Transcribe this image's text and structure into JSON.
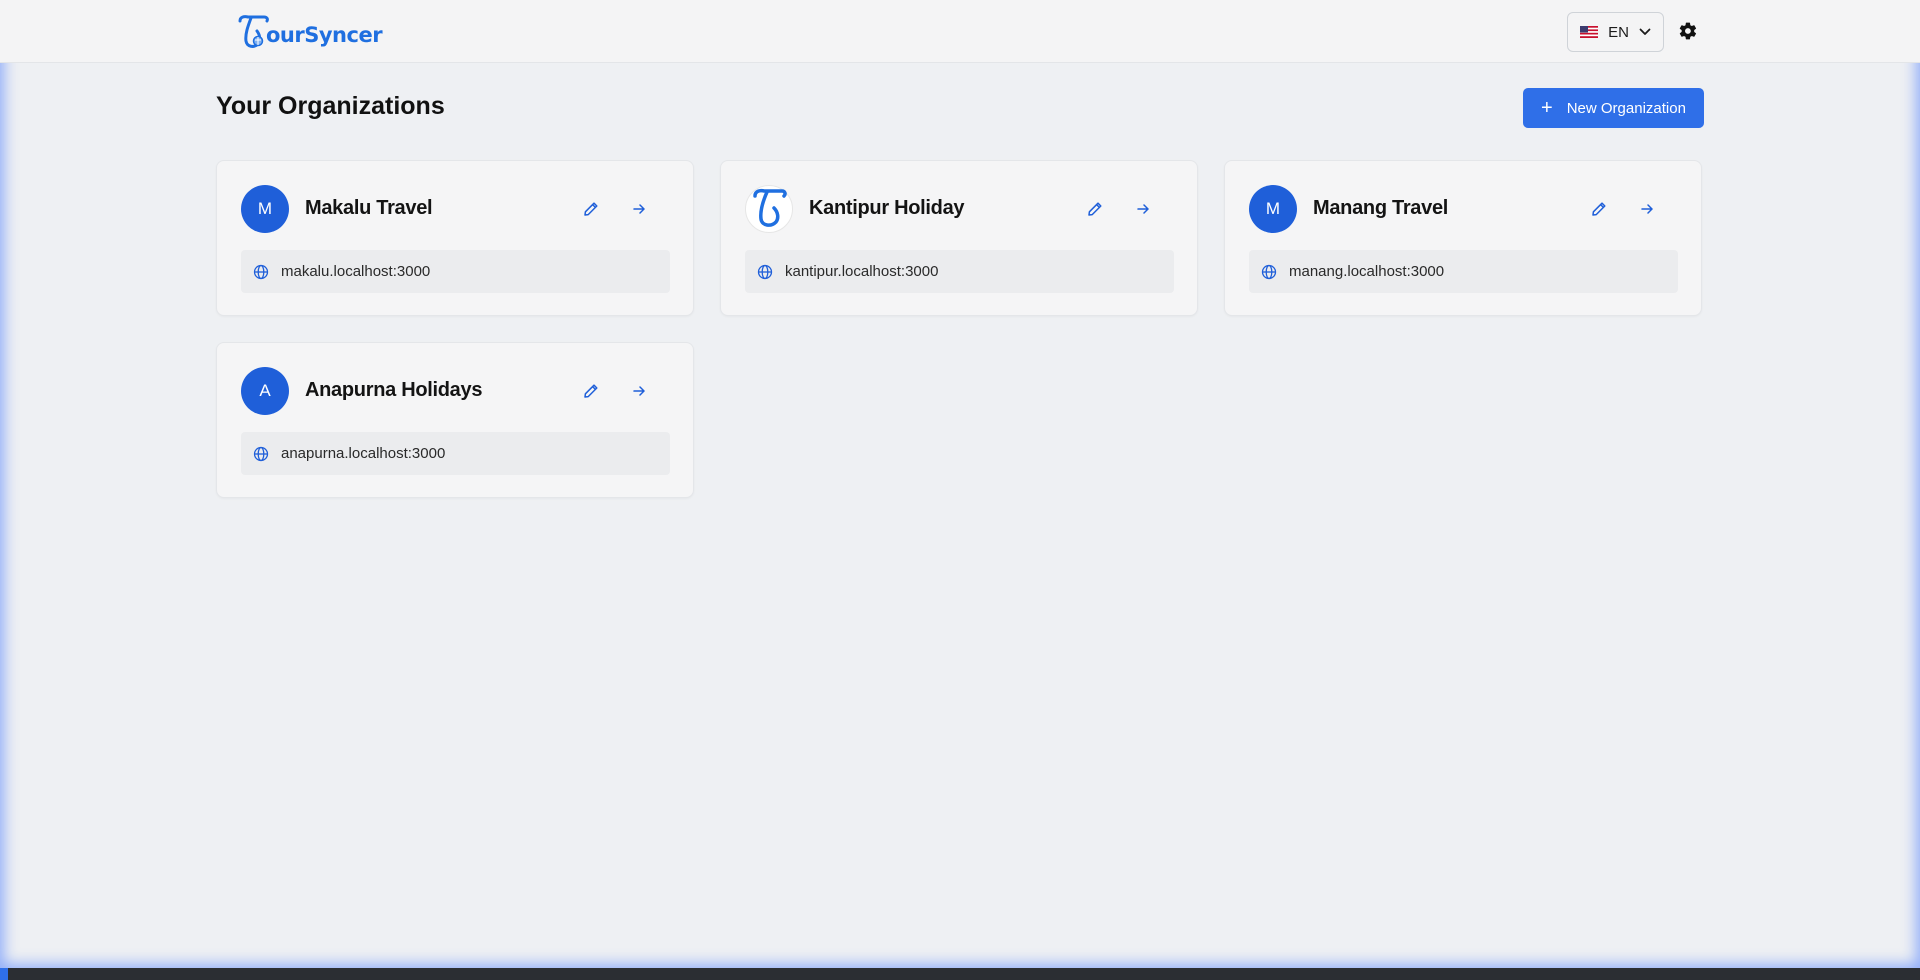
{
  "header": {
    "logo_text": "ourSyncer",
    "language": {
      "code": "EN",
      "flag": "us-flag-icon"
    },
    "settings_icon": "gear-icon"
  },
  "main": {
    "title": "Your Organizations",
    "new_button_label": "New Organization",
    "organizations": [
      {
        "name": "Makalu Travel",
        "initial": "M",
        "domain": "makalu.localhost:3000",
        "avatar": "initial"
      },
      {
        "name": "Kantipur Holiday",
        "initial": "",
        "domain": "kantipur.localhost:3000",
        "avatar": "logo"
      },
      {
        "name": "Manang Travel",
        "initial": "M",
        "domain": "manang.localhost:3000",
        "avatar": "initial"
      },
      {
        "name": "Anapurna Holidays",
        "initial": "A",
        "domain": "anapurna.localhost:3000",
        "avatar": "initial"
      }
    ]
  },
  "colors": {
    "accent": "#2f6fe8",
    "avatar": "#1f5fd9",
    "logo": "#1f6fe0"
  }
}
